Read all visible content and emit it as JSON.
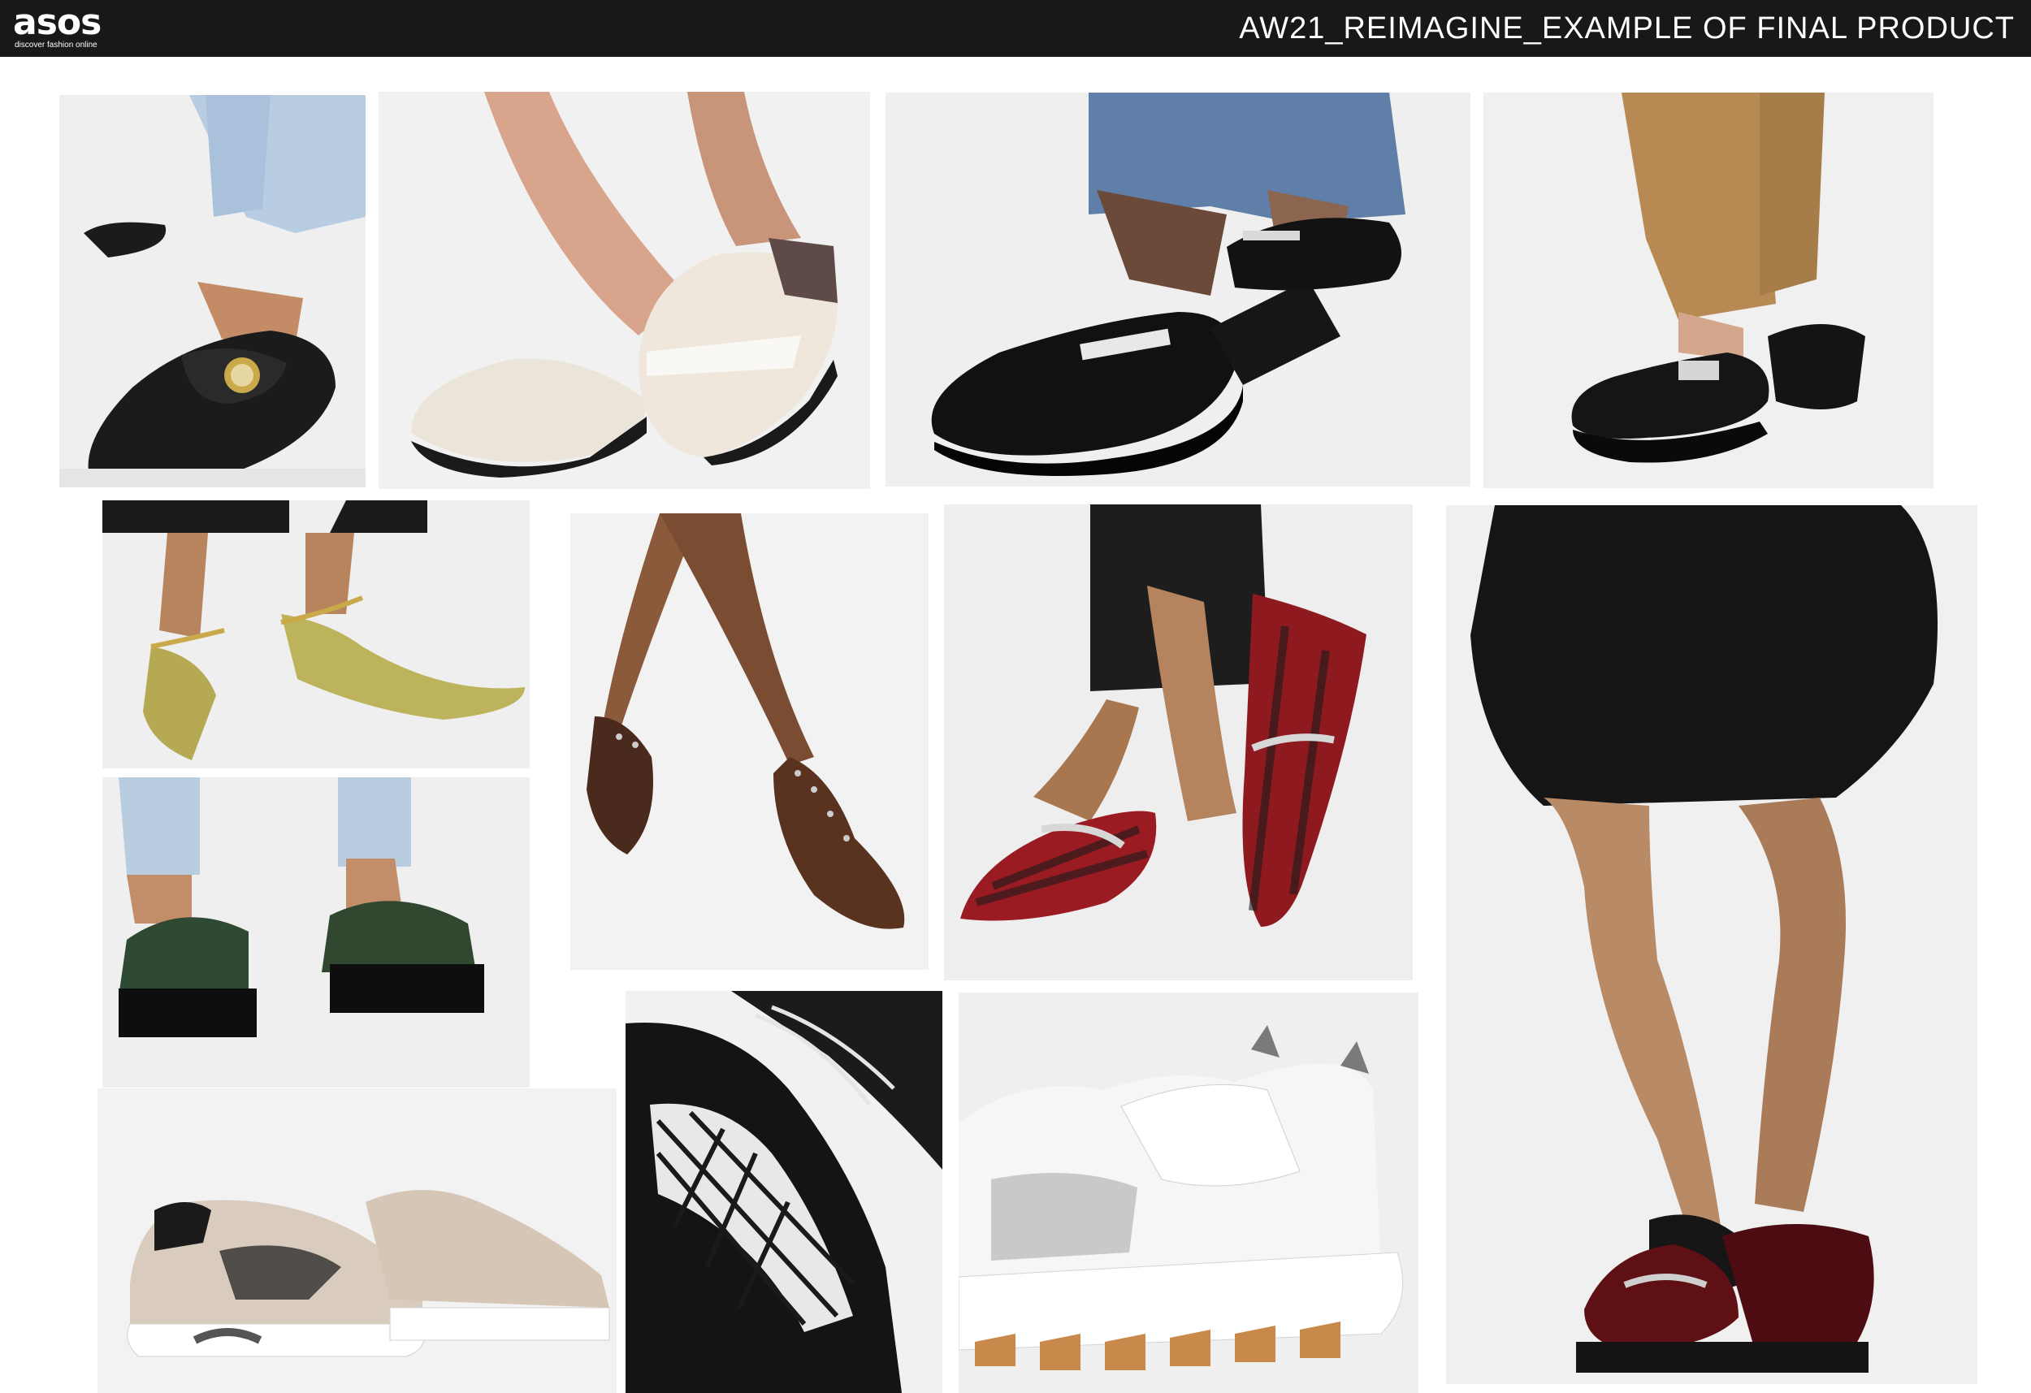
{
  "header": {
    "logo_text": "asos",
    "logo_tagline": "discover fashion online",
    "title": "AW21_REIMAGINE_EXAMPLE OF FINAL PRODUCT"
  },
  "colors": {
    "header_bg": "#1a1718",
    "tile_bg": "#eeeeef"
  },
  "products": [
    {
      "id": "black-loafer-gold-disc",
      "icon": "loafer-photo"
    },
    {
      "id": "cream-backless-loafer-mule",
      "icon": "mule-photo"
    },
    {
      "id": "black-patent-loafer-mule",
      "icon": "mule-photo"
    },
    {
      "id": "black-slingback-loafer",
      "icon": "loafer-photo"
    },
    {
      "id": "olive-patent-chain-flat",
      "icon": "flat-photo"
    },
    {
      "id": "tortoiseshell-studded-flat",
      "icon": "flat-photo"
    },
    {
      "id": "red-check-chain-flat",
      "icon": "flat-photo"
    },
    {
      "id": "burgundy-chunky-chain-loafer",
      "icon": "loafer-photo"
    },
    {
      "id": "green-chunky-lace-up",
      "icon": "lace-up-photo"
    },
    {
      "id": "beige-mesh-trainer",
      "icon": "trainer-photo"
    },
    {
      "id": "black-check-chunky-trainer",
      "icon": "trainer-photo"
    },
    {
      "id": "white-chunky-strap-trainer",
      "icon": "trainer-photo"
    }
  ]
}
